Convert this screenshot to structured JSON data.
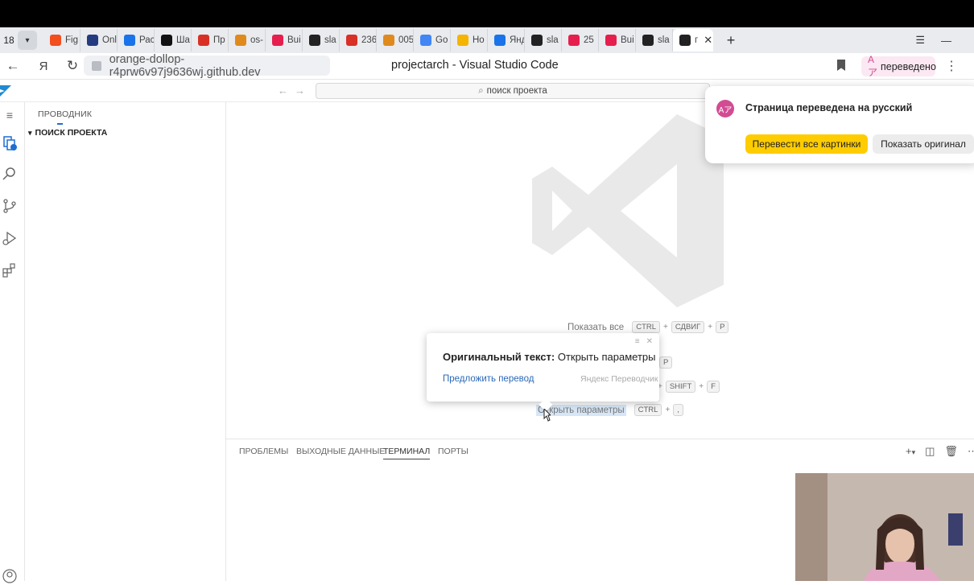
{
  "browser": {
    "tab_count": "18",
    "tabs": [
      {
        "title": "Fig",
        "icon": "figma-icon",
        "color": "#f24e1e"
      },
      {
        "title": "Onl",
        "icon": "paypal-icon",
        "color": "#253b80"
      },
      {
        "title": "Рас",
        "icon": "swoosh-icon",
        "color": "#1a73e8"
      },
      {
        "title": "Ша",
        "icon": "circle-icon",
        "color": "#111111"
      },
      {
        "title": "Пр",
        "icon": "pdf-icon",
        "color": "#d93025"
      },
      {
        "title": "os-",
        "icon": "mh-icon",
        "color": "#e08a1e"
      },
      {
        "title": "Bui",
        "icon": "h-icon",
        "color": "#e61e4d"
      },
      {
        "title": "sla",
        "icon": "github-icon",
        "color": "#222222"
      },
      {
        "title": "236",
        "icon": "mail-icon",
        "color": "#d93025"
      },
      {
        "title": "005",
        "icon": "mh-icon",
        "color": "#e08a1e"
      },
      {
        "title": "Go",
        "icon": "google-icon",
        "color": "#4285f4"
      },
      {
        "title": "Но",
        "icon": "yellow-icon",
        "color": "#f4b400"
      },
      {
        "title": "Янд",
        "icon": "swoosh-icon",
        "color": "#1a73e8"
      },
      {
        "title": "sla",
        "icon": "github-icon",
        "color": "#222222"
      },
      {
        "title": "25",
        "icon": "h-icon",
        "color": "#e61e4d"
      },
      {
        "title": "Bui",
        "icon": "h-icon",
        "color": "#e61e4d"
      },
      {
        "title": "sla",
        "icon": "github-icon",
        "color": "#222222"
      },
      {
        "title": "г",
        "icon": "github-icon",
        "color": "#222222"
      }
    ],
    "url": "orange-dollop-r4prw6v97j9636wj.github.dev",
    "page_title": "projectarch - Visual Studio Code",
    "translated_badge": "переведено"
  },
  "vscode": {
    "command_center": "поиск проекта",
    "explorer_title": "ПРОВОДНИК",
    "explorer_section": "ПОИСК ПРОЕКТА",
    "shortcuts": [
      {
        "label": "Показать все",
        "keys": [
          "CTRL",
          "СДВИГ",
          "P"
        ]
      },
      {
        "label": "",
        "keys": [
          "P"
        ]
      },
      {
        "label": "",
        "keys": [
          "SHIFT",
          "F"
        ]
      },
      {
        "label": "Открыть параметры",
        "keys": [
          "CTRL",
          ","
        ]
      }
    ],
    "panel_tabs": [
      "ПРОБЛЕМЫ",
      "ВЫХОДНЫЕ ДАННЫЕ",
      "ТЕРМИНАЛ",
      "ПОРТЫ"
    ],
    "active_panel_tab": "ТЕРМИНАЛ"
  },
  "translate_popup": {
    "title": "Страница переведена на русский",
    "translate_images": "Перевести все картинки",
    "show_original": "Показать оригинал"
  },
  "original_popup": {
    "label": "Оригинальный текст:",
    "text": "Открыть параметры",
    "suggest": "Предложить перевод",
    "brand": "Яндекс Переводчик"
  }
}
